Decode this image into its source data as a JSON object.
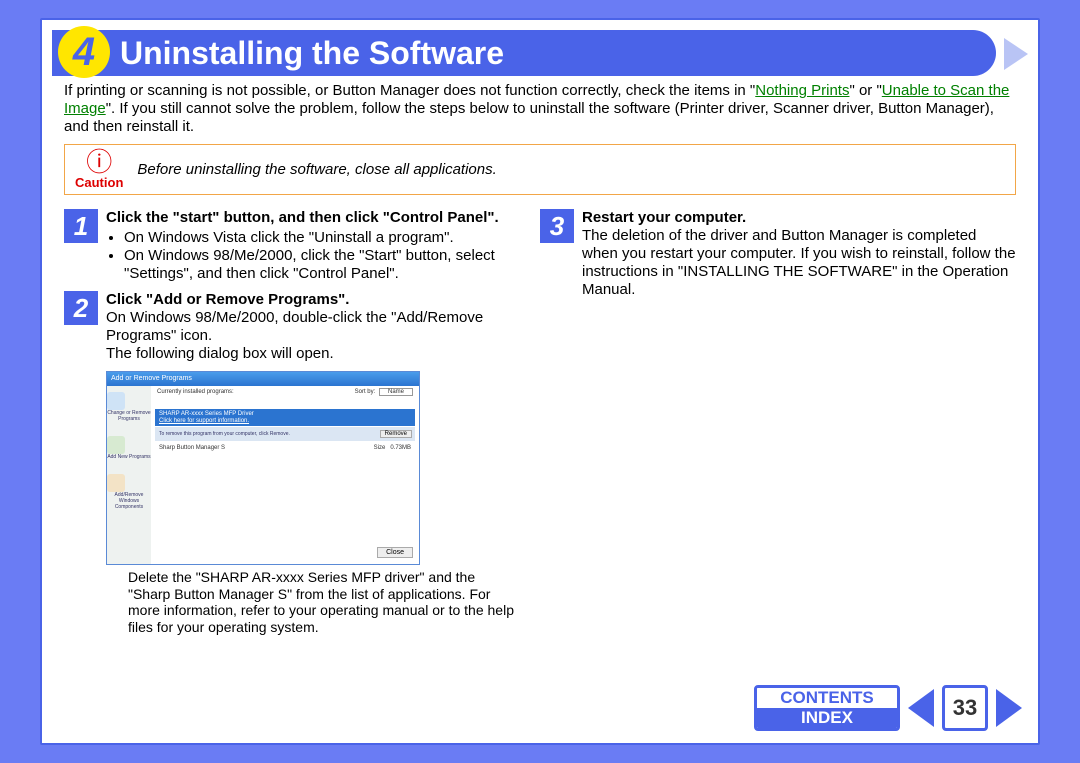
{
  "header": {
    "section_number": "4",
    "title": "Uninstalling the Software"
  },
  "intro": {
    "p1_a": "If printing or scanning is not possible, or Button Manager does not function correctly, check the items in \"",
    "link1": "Nothing Prints",
    "p1_b": "\" or \"",
    "link2": "Unable to Scan the Image",
    "p1_c": "\". If you still cannot solve the problem, follow the steps below to uninstall the software (Printer driver, Scanner driver, Button Manager), and then reinstall it."
  },
  "caution": {
    "label": "Caution",
    "text": "Before uninstalling the software, close all applications."
  },
  "steps": {
    "s1_num": "1",
    "s1_title": "Click the \"start\" button, and then click \"Control Panel\".",
    "s1_b1": "On Windows Vista click the \"Uninstall a program\".",
    "s1_b2": "On Windows 98/Me/2000, click the \"Start\" button, select \"Settings\", and then click \"Control Panel\".",
    "s2_num": "2",
    "s2_title": "Click \"Add or Remove Programs\".",
    "s2_l1": "On Windows 98/Me/2000, double-click the \"Add/Remove Programs\" icon.",
    "s2_l2": "The following dialog box will open.",
    "s3_num": "3",
    "s3_title": "Restart your computer.",
    "s3_body": "The deletion of the driver and Button Manager is completed when you restart your computer. If you wish to reinstall, follow the instructions in \"INSTALLING THE SOFTWARE\" in the Operation Manual."
  },
  "dialog": {
    "title": "Add or Remove Programs",
    "currently_installed": "Currently installed programs:",
    "sort_by": "Sort by:",
    "sort_val": "Name",
    "sel_title": "SHARP AR-xxxx Series MFP Driver",
    "sel_sub": "Click here for support information.",
    "sel_hint": "To remove this program from your computer, click Remove.",
    "remove_btn": "Remove",
    "row2_name": "Sharp Button Manager S",
    "row2_size_lbl": "Size",
    "row2_size": "0.73MB",
    "close_btn": "Close",
    "sb1": "Change or Remove Programs",
    "sb2": "Add New Programs",
    "sb3": "Add/Remove Windows Components"
  },
  "footer_note": "Delete the \"SHARP AR-xxxx Series MFP driver\" and the \"Sharp Button Manager S\" from the list of applications. For more information, refer to your operating manual or to the help files for your operating system.",
  "nav": {
    "contents": "CONTENTS",
    "index": "INDEX",
    "page": "33"
  }
}
